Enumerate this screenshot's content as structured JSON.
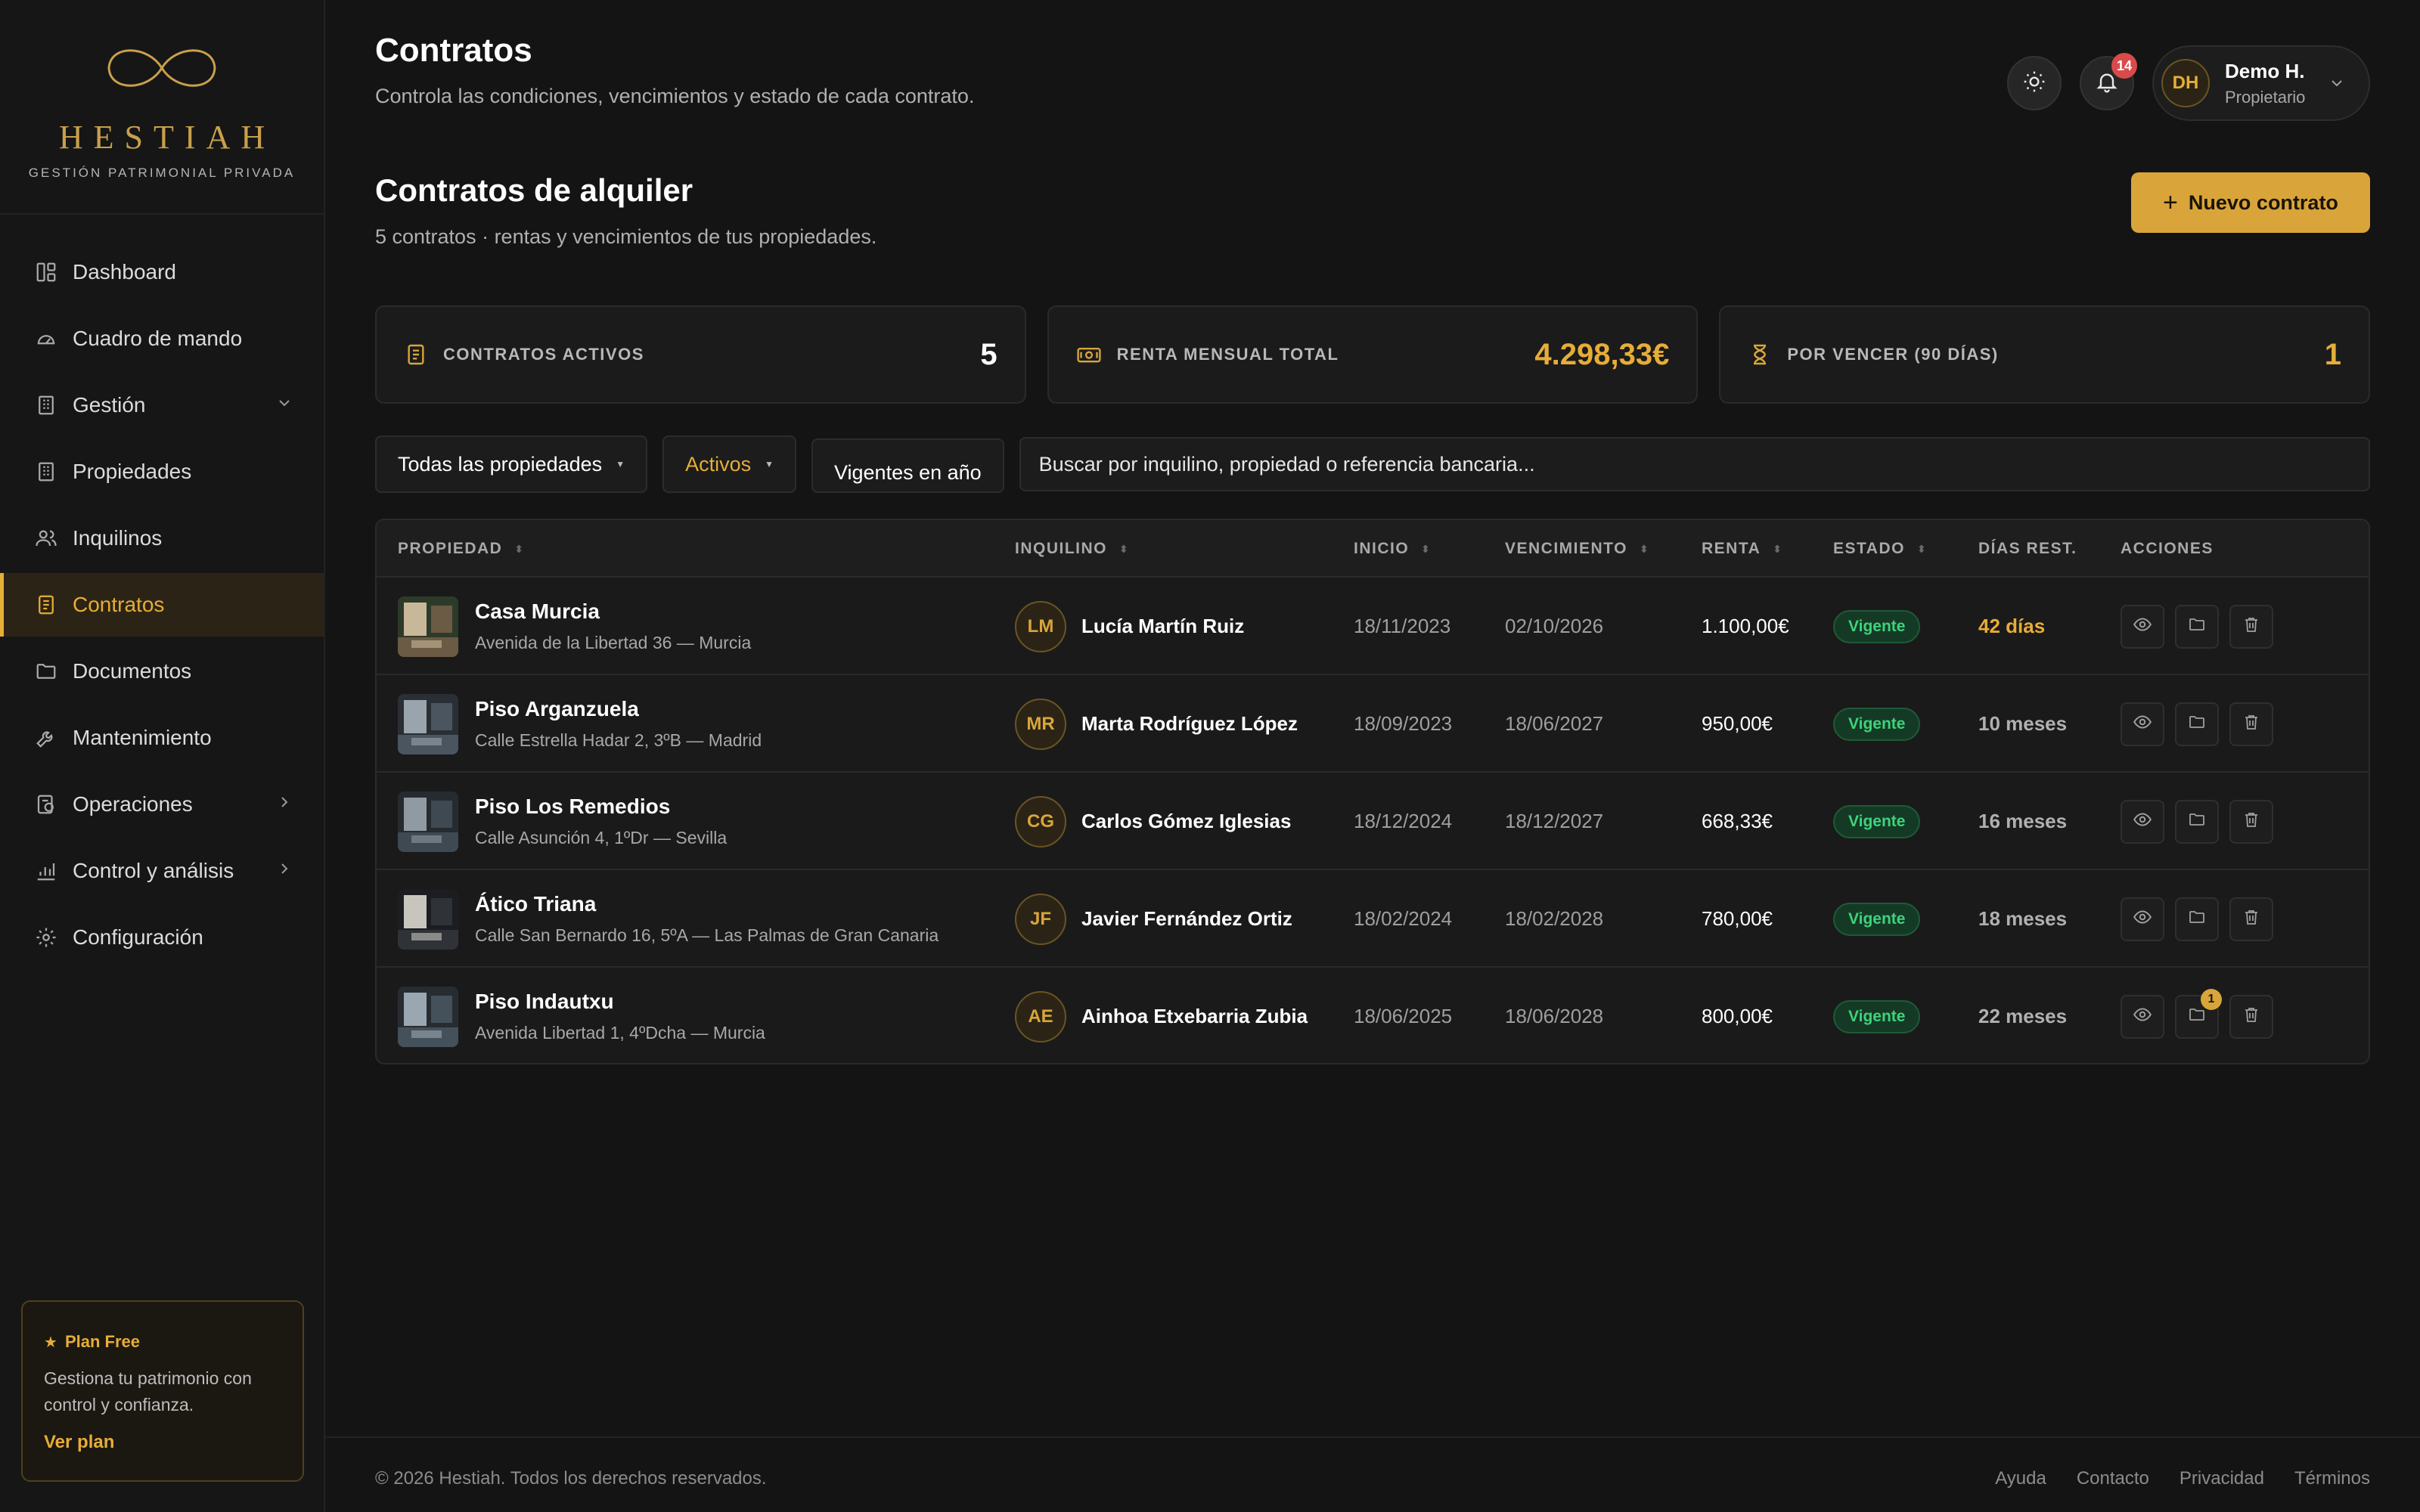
{
  "brand": {
    "name": "HESTIAH",
    "tagline": "GESTIÓN PATRIMONIAL PRIVADA"
  },
  "sidebar": {
    "items": [
      {
        "label": "Dashboard",
        "icon": "layout-icon"
      },
      {
        "label": "Cuadro de mando",
        "icon": "gauge-icon"
      },
      {
        "label": "Gestión",
        "icon": "building-icon",
        "chevron": "down"
      },
      {
        "label": "Propiedades",
        "icon": "building-icon"
      },
      {
        "label": "Inquilinos",
        "icon": "users-icon"
      },
      {
        "label": "Contratos",
        "icon": "document-icon",
        "active": true
      },
      {
        "label": "Documentos",
        "icon": "folder-icon"
      },
      {
        "label": "Mantenimiento",
        "icon": "wrench-icon"
      },
      {
        "label": "Operaciones",
        "icon": "receipt-icon",
        "chevron": "right"
      },
      {
        "label": "Control y análisis",
        "icon": "bar-chart-icon",
        "chevron": "right"
      },
      {
        "label": "Configuración",
        "icon": "gear-icon"
      }
    ],
    "plan": {
      "title": "Plan Free",
      "description": "Gestiona tu patrimonio con control y confianza.",
      "link": "Ver plan"
    }
  },
  "header": {
    "title": "Contratos",
    "subtitle": "Controla las condiciones, vencimientos y estado de cada contrato.",
    "notifications": "14",
    "user": {
      "initials": "DH",
      "name": "Demo H.",
      "role": "Propietario"
    }
  },
  "section": {
    "title": "Contratos de alquiler",
    "subtitle": "5 contratos · rentas y vencimientos de tus propiedades.",
    "new_button": "Nuevo contrato"
  },
  "stats": [
    {
      "label": "CONTRATOS ACTIVOS",
      "value": "5",
      "icon": "document-icon"
    },
    {
      "label": "RENTA MENSUAL TOTAL",
      "value": "4.298,33€",
      "icon": "cash-icon"
    },
    {
      "label": "POR VENCER (90 DÍAS)",
      "value": "1",
      "icon": "hourglass-icon"
    }
  ],
  "filters": {
    "property": "Todas las propiedades",
    "status": "Activos",
    "year_placeholder": "Vigentes en año",
    "search_placeholder": "Buscar por inquilino, propiedad o referencia bancaria..."
  },
  "table": {
    "columns": [
      "PROPIEDAD",
      "INQUILINO",
      "INICIO",
      "VENCIMIENTO",
      "RENTA",
      "ESTADO",
      "DÍAS REST.",
      "ACCIONES"
    ],
    "rows": [
      {
        "property": "Casa Murcia",
        "address": "Avenida de la Libertad 36 — Murcia",
        "initials": "LM",
        "tenant": "Lucía Martín Ruiz",
        "start": "18/11/2023",
        "end": "02/10/2026",
        "rent": "1.100,00€",
        "status": "Vigente",
        "days": "42 días"
      },
      {
        "property": "Piso Arganzuela",
        "address": "Calle Estrella Hadar 2, 3ºB — Madrid",
        "initials": "MR",
        "tenant": "Marta Rodríguez López",
        "start": "18/09/2023",
        "end": "18/06/2027",
        "rent": "950,00€",
        "status": "Vigente",
        "days": "10 meses"
      },
      {
        "property": "Piso Los Remedios",
        "address": "Calle Asunción 4, 1ºDr — Sevilla",
        "initials": "CG",
        "tenant": "Carlos Gómez Iglesias",
        "start": "18/12/2024",
        "end": "18/12/2027",
        "rent": "668,33€",
        "status": "Vigente",
        "days": "16 meses"
      },
      {
        "property": "Ático Triana",
        "address": "Calle San Bernardo 16, 5ºA — Las Palmas de Gran Canaria",
        "initials": "JF",
        "tenant": "Javier Fernández Ortiz",
        "start": "18/02/2024",
        "end": "18/02/2028",
        "rent": "780,00€",
        "status": "Vigente",
        "days": "18 meses"
      },
      {
        "property": "Piso Indautxu",
        "address": "Avenida Libertad 1, 4ºDcha — Murcia",
        "initials": "AE",
        "tenant": "Ainhoa Etxebarria Zubia",
        "start": "18/06/2025",
        "end": "18/06/2028",
        "rent": "800,00€",
        "status": "Vigente",
        "days": "22 meses",
        "folder_badge": "1"
      }
    ]
  },
  "footer": {
    "copyright": "© 2026 Hestiah. Todos los derechos reservados.",
    "links": [
      "Ayuda",
      "Contacto",
      "Privacidad",
      "Términos"
    ]
  },
  "colors": {
    "accent": "#e6ad37",
    "background": "#141414",
    "status_green": "#3fd27a"
  }
}
